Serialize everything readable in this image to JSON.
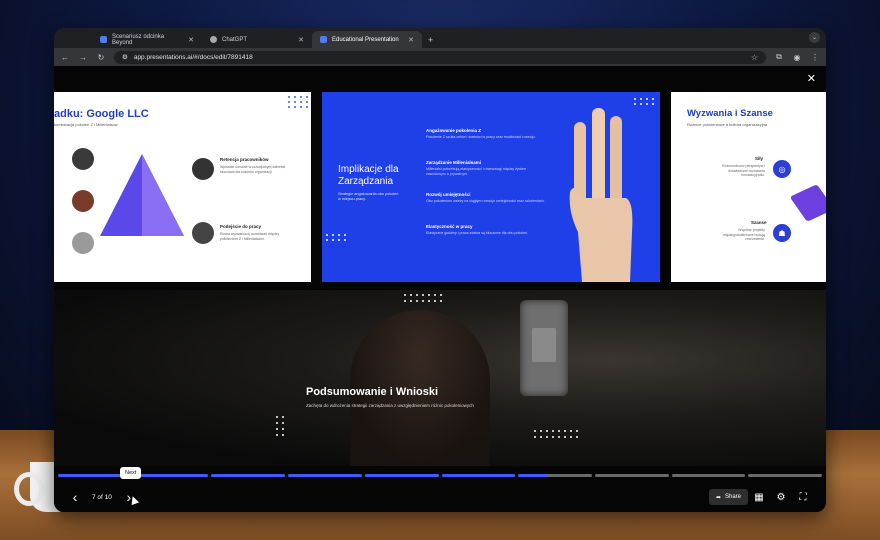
{
  "browser": {
    "tabs": [
      {
        "label": "Scenariusz odcinka Beyond",
        "active": false
      },
      {
        "label": "ChatGPT",
        "active": false
      },
      {
        "label": "Educational Presentation",
        "active": true
      }
    ],
    "new_tab": "+",
    "url": "app.presentations.ai/#/docs/edit/7891418"
  },
  "slides": {
    "left": {
      "title": "adku: Google LLC",
      "subtitle": "kombinacja pokoleń Z i Millenialsów",
      "items": [
        {
          "heading": "Retencja pracowników",
          "body": "Wpisanie uznanie w rozwojowym zakresie, kluczowa dla sukcesu organizacji."
        },
        {
          "heading": "Podejście do pracy",
          "body": "Ekstra wyzwaniach oczekiwań między pokoleniem Z i Millenialsami."
        }
      ]
    },
    "center": {
      "title": "Implikacje dla Zarządzania",
      "subtitle": "Strategie angażowania obu pokoleń w miejscu pracy.",
      "items": [
        {
          "heading": "Angażowanie pokolenia Z",
          "body": "Pokolenie Z szuka celów i wartości w pracy oraz możliwości rozwoju."
        },
        {
          "heading": "Zarządzanie Millenialsami",
          "body": "Millenialsi potrzebują elastyczności i równowagi między życiem zawodowym a prywatnym."
        },
        {
          "heading": "Rozwój umiejętności",
          "body": "Obu pokoleniom zależy na ciągłym rozwoju umiejętności oraz szkoleniach."
        },
        {
          "heading": "Elastyczność w pracy",
          "body": "Elastyczne godziny i praca zdalna są kluczowe dla obu pokoleń."
        }
      ]
    },
    "right": {
      "title": "Wyzwania i Szanse",
      "subtitle": "Różnice pokoleniowe a kultura organizacyjna",
      "items": [
        {
          "heading": "Siły",
          "body": "Różnorodność perspektyw i doświadczeń wzmacnia innowacyjność."
        },
        {
          "heading": "Szanse",
          "body": "Wspólne projekty międzypokoleniowe budują zrozumienie."
        }
      ]
    },
    "main": {
      "title": "Podsumowanie i Wnioski",
      "subtitle": "Zachęta do wdrożenia strategii zarządzania z uwzględnieniem różnic pokoleniowych"
    }
  },
  "player": {
    "counter": "7 of 10",
    "current": 7,
    "total": 10,
    "tooltip": "Next",
    "share_label": "Share"
  },
  "colors": {
    "accent": "#1f3fe8",
    "progress": "#3f5bff"
  }
}
